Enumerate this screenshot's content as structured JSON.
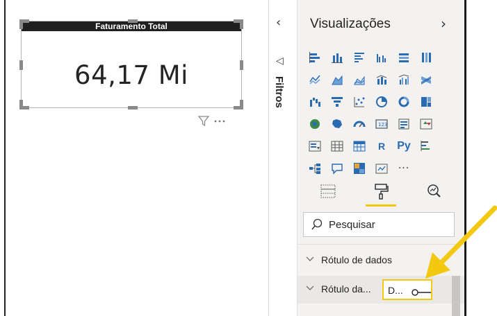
{
  "card": {
    "title": "Faturamento Total",
    "value": "64,17 Mi"
  },
  "filters": {
    "label": "Filtros"
  },
  "visualizations": {
    "title": "Visualizações",
    "icons": [
      "stacked-bar-icon",
      "stacked-column-icon",
      "clustered-bar-icon",
      "clustered-column-icon",
      "100-bar-icon",
      "100-column-icon",
      "line-chart-icon",
      "area-chart-icon",
      "stacked-area-icon",
      "line-column-icon",
      "line-clustered-column-icon",
      "ribbon-chart-icon",
      "waterfall-icon",
      "funnel-icon",
      "scatter-icon",
      "pie-icon",
      "donut-icon",
      "treemap-icon",
      "map-icon",
      "filled-map-icon",
      "gauge-icon",
      "card-icon",
      "multirow-card-icon",
      "kpi-icon",
      "slicer-icon",
      "table-icon",
      "matrix-icon",
      "r-visual-icon",
      "python-visual-icon",
      "key-influencers-icon",
      "decomposition-tree-icon",
      "qna-icon",
      "smart-narrative-icon",
      "paginated-icon",
      "more-icon"
    ],
    "r_label": "R",
    "py_label": "Py",
    "more_label": "···"
  },
  "search": {
    "placeholder": "Pesquisar"
  },
  "sections": [
    {
      "label": "Rótulo de dados"
    },
    {
      "label": "Rótulo da...",
      "sub_label": "D..."
    }
  ],
  "colors": {
    "accent": "#f2c811",
    "brand_blue": "#2a6ab3",
    "card_title_bg": "#1f1f1f"
  }
}
